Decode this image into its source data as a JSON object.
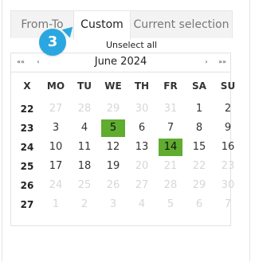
{
  "tabs": [
    "From-To",
    "Custom",
    "Current selection"
  ],
  "active_tab": "Custom",
  "badge": "3",
  "unselect_label": "Unselect all",
  "nav": {
    "prev_year": "««",
    "prev_month": "‹",
    "next_month": "›",
    "next_year": "»»"
  },
  "month_label": "June 2024",
  "headers": [
    "X",
    "MO",
    "TU",
    "WE",
    "TH",
    "FR",
    "SA",
    "SU"
  ],
  "weeks": [
    {
      "num": "22",
      "days": [
        {
          "d": "27",
          "m": true
        },
        {
          "d": "28",
          "m": true
        },
        {
          "d": "29",
          "m": true
        },
        {
          "d": "30",
          "m": true
        },
        {
          "d": "31",
          "m": true
        },
        {
          "d": "1"
        },
        {
          "d": "2"
        }
      ]
    },
    {
      "num": "23",
      "days": [
        {
          "d": "3"
        },
        {
          "d": "4"
        },
        {
          "d": "5",
          "s": true
        },
        {
          "d": "6"
        },
        {
          "d": "7"
        },
        {
          "d": "8"
        },
        {
          "d": "9"
        }
      ]
    },
    {
      "num": "24",
      "days": [
        {
          "d": "10"
        },
        {
          "d": "11"
        },
        {
          "d": "12"
        },
        {
          "d": "13"
        },
        {
          "d": "14",
          "s": true
        },
        {
          "d": "15"
        },
        {
          "d": "16"
        }
      ]
    },
    {
      "num": "25",
      "days": [
        {
          "d": "17"
        },
        {
          "d": "18"
        },
        {
          "d": "19"
        },
        {
          "d": "20",
          "m": true
        },
        {
          "d": "21",
          "m": true
        },
        {
          "d": "22",
          "m": true
        },
        {
          "d": "23",
          "m": true
        }
      ]
    },
    {
      "num": "26",
      "days": [
        {
          "d": "24",
          "m": true
        },
        {
          "d": "25",
          "m": true
        },
        {
          "d": "26",
          "m": true
        },
        {
          "d": "27",
          "m": true
        },
        {
          "d": "28",
          "m": true
        },
        {
          "d": "29",
          "m": true
        },
        {
          "d": "30",
          "m": true
        }
      ]
    },
    {
      "num": "27",
      "days": [
        {
          "d": "1",
          "m": true
        },
        {
          "d": "2",
          "m": true
        },
        {
          "d": "3",
          "m": true
        },
        {
          "d": "4",
          "m": true
        },
        {
          "d": "5",
          "m": true
        },
        {
          "d": "6",
          "m": true
        },
        {
          "d": "7",
          "m": true
        }
      ]
    }
  ],
  "colors": {
    "accent": "#2aa7e0",
    "selected": "#5fac2f",
    "muted": "#d7d7d7"
  }
}
